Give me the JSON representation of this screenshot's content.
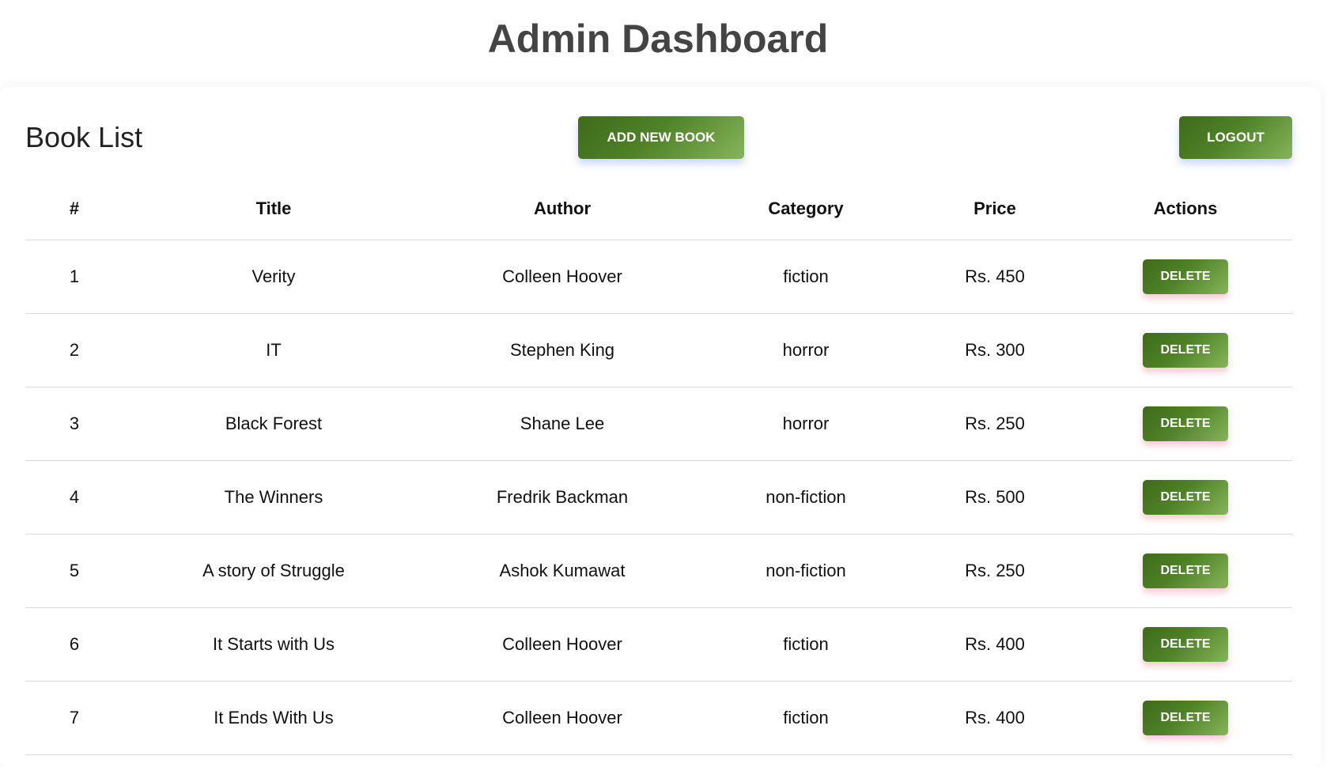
{
  "page": {
    "title": "Admin Dashboard"
  },
  "book_list": {
    "heading": "Book List",
    "add_button_label": "ADD NEW BOOK",
    "logout_button_label": "LOGOUT"
  },
  "table": {
    "headers": [
      "#",
      "Title",
      "Author",
      "Category",
      "Price",
      "Actions"
    ],
    "delete_label": "DELETE",
    "rows": [
      {
        "num": "1",
        "title": "Verity",
        "author": "Colleen Hoover",
        "category": "fiction",
        "price": "Rs. 450"
      },
      {
        "num": "2",
        "title": "IT",
        "author": "Stephen King",
        "category": "horror",
        "price": "Rs. 300"
      },
      {
        "num": "3",
        "title": "Black Forest",
        "author": "Shane Lee",
        "category": "horror",
        "price": "Rs. 250"
      },
      {
        "num": "4",
        "title": "The Winners",
        "author": "Fredrik Backman",
        "category": "non-fiction",
        "price": "Rs. 500"
      },
      {
        "num": "5",
        "title": "A story of Struggle",
        "author": "Ashok Kumawat",
        "category": "non-fiction",
        "price": "Rs. 250"
      },
      {
        "num": "6",
        "title": "It Starts with Us",
        "author": "Colleen Hoover",
        "category": "fiction",
        "price": "Rs. 400"
      },
      {
        "num": "7",
        "title": "It Ends With Us",
        "author": "Colleen Hoover",
        "category": "fiction",
        "price": "Rs. 400"
      }
    ]
  },
  "colors": {
    "button_gradient_start": "#3e6b1b",
    "button_gradient_end": "#86b45a",
    "title_text": "#444444",
    "row_divider": "#d9d9d9"
  }
}
